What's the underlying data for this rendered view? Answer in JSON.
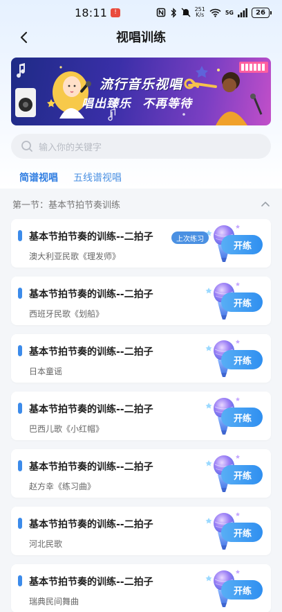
{
  "status_bar": {
    "time": "18:11",
    "net_speed_value": "251",
    "net_speed_unit": "K/s",
    "network_type": "5G",
    "battery": "26"
  },
  "header": {
    "title": "视唱训练"
  },
  "banner": {
    "line1": "流行音乐视唱",
    "line2a": "唱出臻乐",
    "line2b": "不再等待"
  },
  "search": {
    "placeholder": "输入你的关键字"
  },
  "tabs": [
    {
      "label": "简谱视唱",
      "active": true
    },
    {
      "label": "五线谱视唱",
      "active": false
    }
  ],
  "section": {
    "title": "第一节：基本节拍节奏训练"
  },
  "lessons": [
    {
      "title": "基本节拍节奏的训练--二拍子",
      "subtitle": "澳大利亚民歌《理发师》",
      "badge": "上次练习",
      "button": "开练"
    },
    {
      "title": "基本节拍节奏的训练--二拍子",
      "subtitle": "西班牙民歌《划船》",
      "button": "开练"
    },
    {
      "title": "基本节拍节奏的训练--二拍子",
      "subtitle": "日本童谣",
      "button": "开练"
    },
    {
      "title": "基本节拍节奏的训练--二拍子",
      "subtitle": "巴西儿歌《小红帽》",
      "button": "开练"
    },
    {
      "title": "基本节拍节奏的训练--二拍子",
      "subtitle": "赵方幸《练习曲》",
      "button": "开练"
    },
    {
      "title": "基本节拍节奏的训练--二拍子",
      "subtitle": "河北民歌",
      "button": "开练"
    },
    {
      "title": "基本节拍节奏的训练--二拍子",
      "subtitle": "瑞典民间舞曲",
      "button": "开练"
    }
  ],
  "colors": {
    "accent": "#2f7de1",
    "card_bar": "#3c8bea",
    "button_start": "#58aef5",
    "button_end": "#2f8ff0"
  },
  "icons": {
    "status": [
      "app-alert-icon",
      "nfc-icon",
      "bluetooth-icon",
      "mute-icon",
      "wifi-icon",
      "signal-icon",
      "battery-icon"
    ],
    "nav": "back-arrow-icon",
    "search": "search-icon",
    "section": "chevron-up-icon",
    "lesson": "microphone-icon"
  }
}
